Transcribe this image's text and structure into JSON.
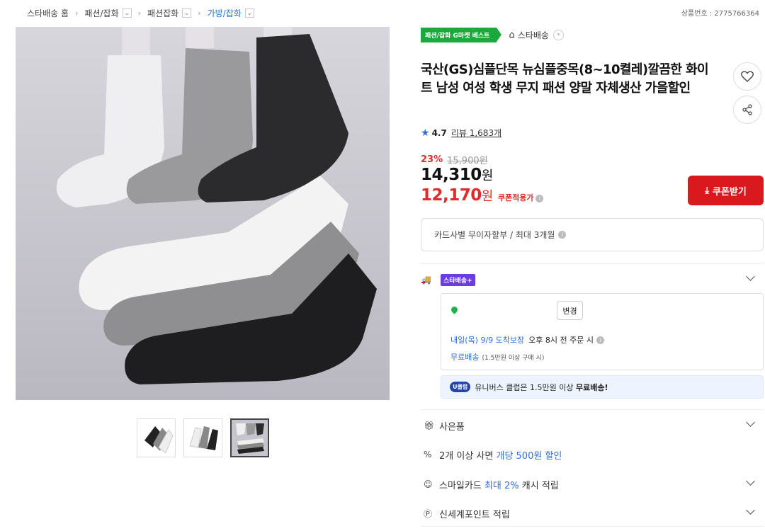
{
  "breadcrumb": {
    "items": [
      {
        "label": "스타배송 홈",
        "toggle": false
      },
      {
        "label": "패션/잡화",
        "toggle": true
      },
      {
        "label": "패션잡화",
        "toggle": true
      },
      {
        "label": "가방/잡화",
        "toggle": true
      }
    ]
  },
  "product_no": "상품번호 : 2775766364",
  "tags": {
    "best": "패션/잡화 G마켓 베스트",
    "store": "스타배송"
  },
  "title": "국산(GS)심플단목 뉴심플중목(8~10켤레)깔끔한 화이트 남성 여성 학생 무지 패션 양말 자체생산 가을할인",
  "rating": {
    "score": "4.7",
    "reviews": "리뷰 1,683개"
  },
  "price": {
    "discount": "23%",
    "original": "15,900원",
    "sale": "14,310",
    "sale_unit": "원",
    "coupon": "12,170",
    "coupon_unit": "원",
    "coupon_label": "쿠폰적용가"
  },
  "coupon_button": "쿠폰받기",
  "installment": "카드사별 무이자할부 / 최대 3개월",
  "shipping": {
    "badge": "스타배송+",
    "change": "변경",
    "arrival_blue": "내일(목) 9/9 도착보장",
    "arrival_rest": "오후 8시 전 주문 시",
    "free_blue": "무료배송",
    "free_note": "(1.5만원 이상 구매 시)"
  },
  "club": {
    "badge": "U클럽",
    "text": "유니버스 클럽은 1.5만원 이상",
    "bold": "무료배송!"
  },
  "options": {
    "gift": "사은품",
    "multi_prefix": "2개 이상 사면",
    "multi_hl": "개당 500원 할인",
    "smile_prefix": "스마일카드",
    "smile_hl": "최대 2%",
    "smile_suffix": "캐시 적립",
    "point": "신세계포인트 적립"
  },
  "icons": [
    "home-icon",
    "heart-icon",
    "share-icon",
    "star-icon",
    "truck-icon",
    "pin-icon",
    "gift-icon",
    "discount-icon",
    "smile-card-icon",
    "point-icon",
    "chevron-down-icon",
    "download-icon"
  ],
  "colors": {
    "accent_red": "#d9191e",
    "best_green": "#1ca93c",
    "link_blue": "#2f6fd6",
    "star_delivery_purple": "#6b3ce0"
  }
}
